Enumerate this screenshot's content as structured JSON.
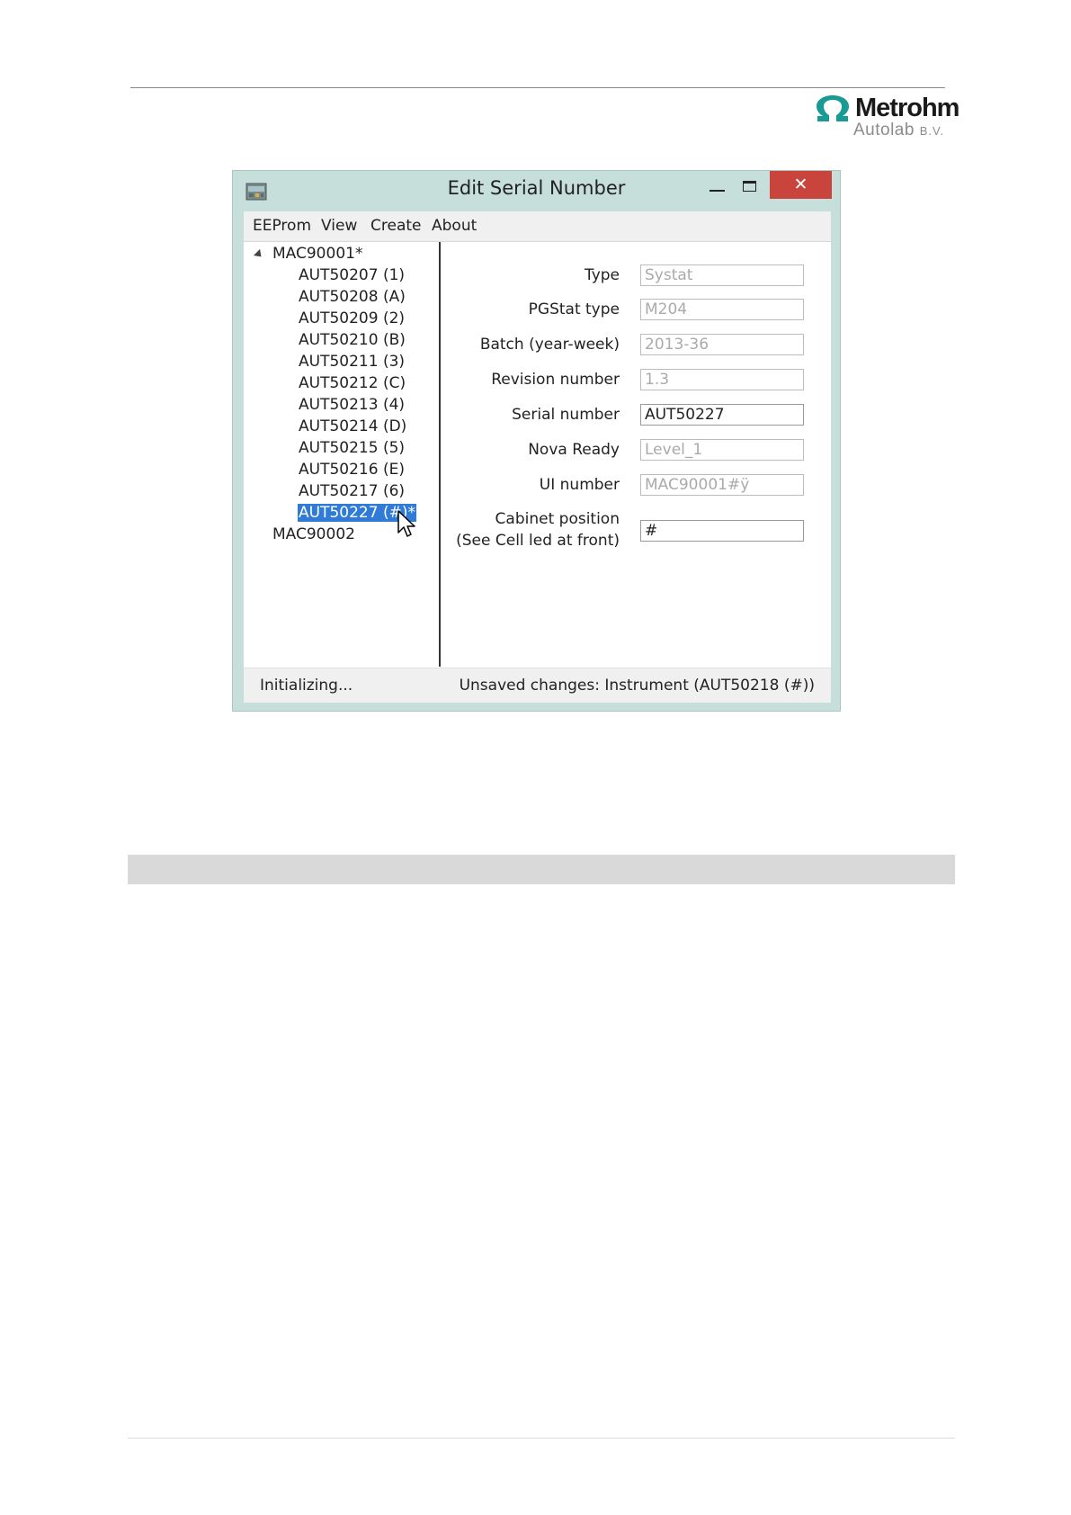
{
  "header": {
    "logo_brand": "Metrohm",
    "logo_sub": "Autolab",
    "logo_sub_suffix": "B.V."
  },
  "window": {
    "title": "Edit Serial Number",
    "close_glyph": "✕",
    "menu": [
      "EEProm",
      "View",
      "Create",
      "About"
    ],
    "tree": {
      "root1": "MAC90001*",
      "children": [
        "AUT50207 (1)",
        "AUT50208 (A)",
        "AUT50209 (2)",
        "AUT50210 (B)",
        "AUT50211 (3)",
        "AUT50212 (C)",
        "AUT50213 (4)",
        "AUT50214 (D)",
        "AUT50215 (5)",
        "AUT50216 (E)",
        "AUT50217 (6)",
        "AUT50227 (#)*"
      ],
      "root2": "MAC90002",
      "selected_color": "#2f7bd5"
    },
    "form": {
      "fields": [
        {
          "label": "Type",
          "value": "Systat"
        },
        {
          "label": "PGStat type",
          "value": "M204"
        },
        {
          "label": "Batch (year-week)",
          "value": "2013-36"
        },
        {
          "label": "Revision number",
          "value": "1.3"
        },
        {
          "label": "Serial number",
          "value": "AUT50227"
        },
        {
          "label": "Nova Ready",
          "value": "Level_1"
        },
        {
          "label": "UI number",
          "value": "MAC90001#ÿ"
        },
        {
          "label_line1": "Cabinet position",
          "label_line2": "(See Cell led at front)",
          "value": "#"
        }
      ]
    },
    "status": {
      "left": "Initializing...",
      "right": "Unsaved changes: Instrument (AUT50218 (#))"
    },
    "colors": {
      "frame": "#c6dfdb",
      "close_button": "#c9443c",
      "logo_teal": "#1a9a94"
    }
  }
}
